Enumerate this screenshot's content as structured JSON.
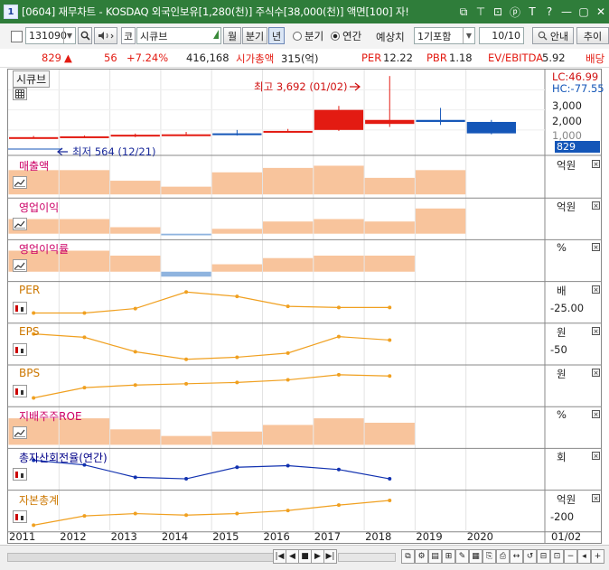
{
  "window": {
    "number": "1",
    "title": "[0604] 재무차트 - KOSDAQ 외국인보유[1,280(천)] 주식수[38,000(천)] 액면[100] 자!",
    "buttons": [
      "⧉",
      "⊤",
      "⊡",
      "ⓟ",
      "T",
      "?",
      "—",
      "▢",
      "✕"
    ]
  },
  "toolbar": {
    "stock_code": "131090",
    "market_label": "코",
    "stock_name": "시큐브",
    "btn_monthly": "월",
    "btn_quarter": "분기",
    "btn_year": "년",
    "radio_quarter": "분기",
    "radio_annual": "연간",
    "forecast_label": "예상치",
    "forecast_value": "1기포함",
    "page_value": "10/10",
    "guide_label": "안내",
    "add_label": "추이"
  },
  "quote": {
    "price": "829",
    "change_symbol": "▲",
    "change": "56",
    "change_pct": "+7.24%",
    "volume": "416,168",
    "mktcap_label": "시가총액",
    "mktcap_value": "315(억)",
    "per_label": "PER",
    "per_value": "12.22",
    "pbr_label": "PBR",
    "pbr_value": "1.18",
    "ev_label": "EV/EBITDA",
    "ev_value": "5.92",
    "div_label": "배당"
  },
  "price_panel": {
    "title": "시큐브",
    "lc": "LC:46.99",
    "hc": "HC:-77.55",
    "high_note": "최고 3,692 (01/02)",
    "low_note": "최저 564 (12/21)",
    "ticks": [
      "3,000",
      "2,000",
      "1,000"
    ],
    "current_tag": "829"
  },
  "panels": [
    {
      "name": "sales",
      "label": "매출액",
      "unit": "억원",
      "tick": "",
      "color": "#cc0066"
    },
    {
      "name": "op-income",
      "label": "영업이익",
      "unit": "억원",
      "tick": "",
      "color": "#cc0066"
    },
    {
      "name": "op-margin",
      "label": "영업이익률",
      "unit": "%",
      "tick": "",
      "color": "#cc0066"
    },
    {
      "name": "per",
      "label": "PER",
      "unit": "배",
      "tick": "25.00",
      "color": "#cc7700"
    },
    {
      "name": "eps",
      "label": "EPS",
      "unit": "원",
      "tick": "50",
      "color": "#cc7700"
    },
    {
      "name": "bps",
      "label": "BPS",
      "unit": "원",
      "tick": "",
      "color": "#cc7700"
    },
    {
      "name": "roe",
      "label": "지배주주ROE",
      "unit": "%",
      "tick": "",
      "color": "#cc0066"
    },
    {
      "name": "turnover",
      "label": "총자산회전율(연간)",
      "unit": "회",
      "tick": "",
      "color": "#000088"
    },
    {
      "name": "equity",
      "label": "자본총계",
      "unit": "억원",
      "tick": "200",
      "color": "#cc7700"
    }
  ],
  "x_axis": {
    "years": [
      "2011",
      "2012",
      "2013",
      "2014",
      "2015",
      "2016",
      "2017",
      "2018",
      "2019",
      "2020"
    ],
    "right_label": "01/02"
  },
  "colors": {
    "up": "#e31b12",
    "down": "#1456b8",
    "bar": "#f8c49c",
    "bar_neg": "#8fb4df",
    "line_orange": "#f0a020",
    "line_blue": "#1232b0",
    "title_green": "#2f7d3a"
  },
  "chart_data": [
    {
      "type": "candlestick",
      "title": "시큐브",
      "x": [
        "2011",
        "2012",
        "2013",
        "2014",
        "2015",
        "2016",
        "2017",
        "2018",
        "2019",
        "2020"
      ],
      "open": [
        610,
        650,
        700,
        760,
        830,
        900,
        1000,
        1300,
        1500,
        1400
      ],
      "close": [
        640,
        680,
        760,
        780,
        780,
        950,
        2000,
        1500,
        1400,
        829
      ],
      "high": [
        700,
        720,
        820,
        900,
        1000,
        1050,
        2200,
        3692,
        2100,
        1500
      ],
      "low": [
        564,
        600,
        640,
        700,
        720,
        880,
        950,
        1150,
        1250,
        780
      ],
      "ylim": [
        0,
        3700
      ]
    },
    {
      "type": "bar",
      "title": "매출액",
      "x": [
        "2011",
        "2012",
        "2013",
        "2014",
        "2015",
        "2016",
        "2017",
        "2018",
        "2019"
      ],
      "values": [
        110,
        110,
        62,
        35,
        100,
        120,
        130,
        75,
        110
      ],
      "ylim": [
        0,
        140
      ]
    },
    {
      "type": "bar",
      "title": "영업이익",
      "x": [
        "2011",
        "2012",
        "2013",
        "2014",
        "2015",
        "2016",
        "2017",
        "2018",
        "2019"
      ],
      "values": [
        18,
        18,
        8,
        -2,
        6,
        15,
        18,
        15,
        31
      ],
      "ylim": [
        -3,
        35
      ]
    },
    {
      "type": "bar",
      "title": "영업이익률",
      "x": [
        "2011",
        "2012",
        "2013",
        "2014",
        "2015",
        "2016",
        "2017",
        "2018"
      ],
      "values": [
        17,
        17,
        13,
        -4,
        6,
        11,
        13,
        13
      ],
      "ylim": [
        -5,
        20
      ]
    },
    {
      "type": "line",
      "title": "PER",
      "x": [
        "2011",
        "2012",
        "2013",
        "2014",
        "2015",
        "2016",
        "2017",
        "2018"
      ],
      "values": [
        16,
        16,
        20,
        35,
        31,
        22,
        21,
        21
      ],
      "ylim": [
        10,
        38
      ]
    },
    {
      "type": "line",
      "title": "EPS",
      "x": [
        "2011",
        "2012",
        "2013",
        "2014",
        "2015",
        "2016",
        "2017",
        "2018"
      ],
      "values": [
        60,
        55,
        34,
        23,
        26,
        32,
        56,
        51
      ],
      "ylim": [
        20,
        65
      ]
    },
    {
      "type": "line",
      "title": "BPS",
      "x": [
        "2011",
        "2012",
        "2013",
        "2014",
        "2015",
        "2016",
        "2017",
        "2018"
      ],
      "values": [
        420,
        460,
        470,
        475,
        480,
        490,
        510,
        505
      ],
      "ylim": [
        400,
        520
      ]
    },
    {
      "type": "bar",
      "title": "지배주주ROE",
      "x": [
        "2011",
        "2012",
        "2013",
        "2014",
        "2015",
        "2016",
        "2017",
        "2018"
      ],
      "values": [
        12,
        12,
        7,
        4,
        6,
        9,
        12,
        10
      ],
      "ylim": [
        0,
        14
      ]
    },
    {
      "type": "line",
      "title": "총자산회전율(연간)",
      "x": [
        "2011",
        "2012",
        "2013",
        "2014",
        "2015",
        "2016",
        "2017",
        "2018"
      ],
      "values": [
        0.84,
        0.78,
        0.62,
        0.6,
        0.75,
        0.77,
        0.72,
        0.6
      ],
      "ylim": [
        0.5,
        0.9
      ]
    },
    {
      "type": "line",
      "title": "자본총계",
      "x": [
        "2011",
        "2012",
        "2013",
        "2014",
        "2015",
        "2016",
        "2017",
        "2018"
      ],
      "values": [
        120,
        180,
        195,
        185,
        195,
        215,
        250,
        280
      ],
      "ylim": [
        100,
        300
      ]
    }
  ]
}
